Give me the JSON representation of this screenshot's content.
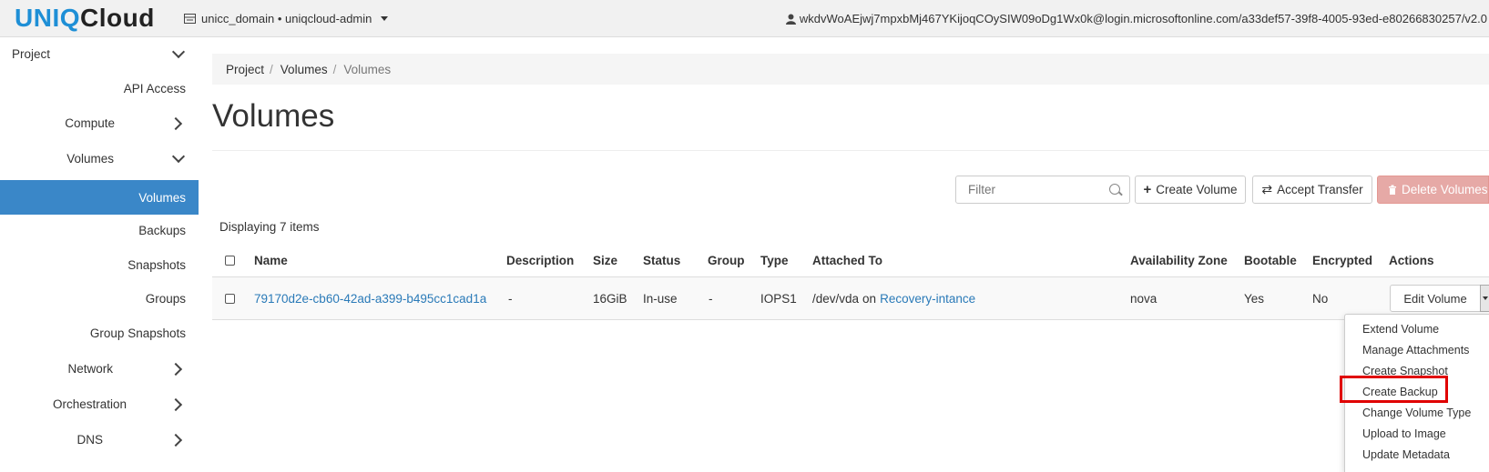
{
  "header": {
    "logo_part1": "UNIQ",
    "logo_part2": "Cloud",
    "domain_switcher": "unicc_domain • uniqcloud-admin",
    "user": "wkdvWoAEjwj7mpxbMj467YKijoqCOySIW09oDg1Wx0k@login.microsoftonline.com/a33def57-39f8-4005-93ed-e80266830257/v2.0"
  },
  "sidebar": {
    "project": "Project",
    "api_access": "API Access",
    "compute": "Compute",
    "volumes": "Volumes",
    "volumes_sub": {
      "volumes": "Volumes",
      "backups": "Backups",
      "snapshots": "Snapshots",
      "groups": "Groups",
      "group_snapshots": "Group Snapshots"
    },
    "network": "Network",
    "orchestration": "Orchestration",
    "dns": "DNS"
  },
  "breadcrumb": [
    "Project",
    "Volumes",
    "Volumes"
  ],
  "page_title": "Volumes",
  "toolbar": {
    "filter_placeholder": "Filter",
    "create_volume": "Create Volume",
    "accept_transfer": "Accept Transfer",
    "delete_volumes": "Delete Volumes"
  },
  "item_count": "Displaying 7 items",
  "table": {
    "headers": {
      "name": "Name",
      "description": "Description",
      "size": "Size",
      "status": "Status",
      "group": "Group",
      "type": "Type",
      "attached_to": "Attached To",
      "availability_zone": "Availability Zone",
      "bootable": "Bootable",
      "encrypted": "Encrypted",
      "actions": "Actions"
    },
    "row": {
      "name": "79170d2e-cb60-42ad-a399-b495cc1cad1a",
      "description": "-",
      "size": "16GiB",
      "status": "In-use",
      "group": "-",
      "type": "IOPS1",
      "attached_device": "/dev/vda",
      "attached_on": "on",
      "attached_instance": "Recovery-intance",
      "availability_zone": "nova",
      "bootable": "Yes",
      "encrypted": "No",
      "action_button": "Edit Volume"
    }
  },
  "actions_menu": {
    "items": [
      "Extend Volume",
      "Manage Attachments",
      "Create Snapshot",
      "Create Backup",
      "Change Volume Type",
      "Upload to Image",
      "Update Metadata"
    ],
    "highlighted_item": "Create Backup"
  },
  "colors": {
    "brand_blue": "#1e8fd6",
    "sidebar_active": "#3a87c8",
    "link": "#2a7ab8",
    "danger_button": "#e6a9a6",
    "highlight_box": "#e00000"
  }
}
